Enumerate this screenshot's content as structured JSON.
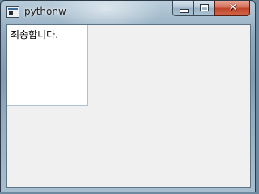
{
  "window": {
    "title": "pythonw",
    "app_icon": "python-window-icon"
  },
  "caption_buttons": {
    "minimize_icon": "minimize-icon",
    "maximize_icon": "maximize-icon",
    "close_icon": "close-icon",
    "close_glyph": "✕"
  },
  "content": {
    "message": "죄송합니다."
  },
  "colors": {
    "client_background": "#f0f0f0",
    "text_area_background": "#ffffff",
    "close_button": "#c74a2e"
  }
}
